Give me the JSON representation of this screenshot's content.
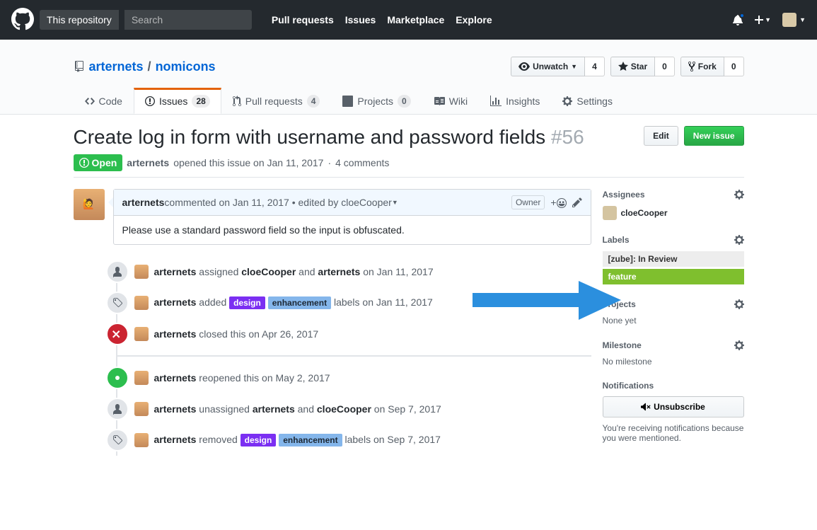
{
  "top": {
    "scope": "This repository",
    "search_placeholder": "Search",
    "nav": {
      "pulls": "Pull requests",
      "issues": "Issues",
      "marketplace": "Marketplace",
      "explore": "Explore"
    }
  },
  "repo": {
    "owner": "arternets",
    "name": "nomicons",
    "actions": {
      "unwatch": "Unwatch",
      "watch_count": "4",
      "star": "Star",
      "star_count": "0",
      "fork": "Fork",
      "fork_count": "0"
    }
  },
  "tabs": {
    "code": "Code",
    "issues": "Issues",
    "issues_count": "28",
    "pulls": "Pull requests",
    "pulls_count": "4",
    "projects": "Projects",
    "projects_count": "0",
    "wiki": "Wiki",
    "insights": "Insights",
    "settings": "Settings"
  },
  "issue": {
    "title": "Create log in form with username and password fields",
    "number": "#56",
    "edit": "Edit",
    "new": "New issue",
    "state": "Open",
    "author": "arternets",
    "opened": "opened this issue on Jan 11, 2017",
    "comments": "4 comments"
  },
  "comment": {
    "author": "arternets",
    "meta": " commented on Jan 11, 2017 • edited by cloeCooper ",
    "owner": "Owner",
    "body": "Please use a standard password field so the input is obfuscated."
  },
  "timeline": {
    "l1": {
      "a": "arternets",
      "t1": " assigned ",
      "u1": "cloeCooper",
      "t2": " and ",
      "u2": "arternets",
      "t3": " on Jan 11, 2017"
    },
    "l2": {
      "a": "arternets",
      "t1": " added ",
      "lab1": "design",
      "lab2": "enhancement",
      "t2": " labels on Jan 11, 2017"
    },
    "l3": {
      "a": "arternets",
      "t": " closed this on Apr 26, 2017"
    },
    "l4": {
      "a": "arternets",
      "t": " reopened this on May 2, 2017"
    },
    "l5": {
      "a": "arternets",
      "t1": " unassigned ",
      "u1": "arternets",
      "t2": " and ",
      "u2": "cloeCooper",
      "t3": " on Sep 7, 2017"
    },
    "l6": {
      "a": "arternets",
      "t1": " removed ",
      "lab1": "design",
      "lab2": "enhancement",
      "t2": " labels on Sep 7, 2017"
    }
  },
  "sidebar": {
    "assignees": {
      "title": "Assignees",
      "user": "cloeCooper"
    },
    "labels": {
      "title": "Labels",
      "l1": "[zube]: In Review",
      "l2": "feature"
    },
    "projects": {
      "title": "Projects",
      "none": "None yet"
    },
    "milestone": {
      "title": "Milestone",
      "none": "No milestone"
    },
    "notifications": {
      "title": "Notifications",
      "btn": "Unsubscribe",
      "note": "You're receiving notifications because you were mentioned."
    }
  },
  "colors": {
    "design": "#7b2ff2",
    "enhancement": "#84b6eb",
    "feature": "#7fbf2e",
    "zube": "#ededed"
  }
}
